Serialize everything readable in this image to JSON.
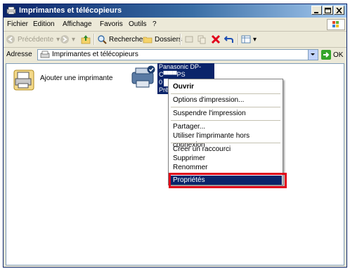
{
  "window": {
    "title": "Imprimantes et télécopieurs",
    "colors": {
      "titlebar": "#0a246a",
      "highlight": "#0a246a",
      "callout": "#e1001a"
    }
  },
  "menubar": {
    "items": [
      "Fichier",
      "Edition",
      "Affichage",
      "Favoris",
      "Outils",
      "?"
    ]
  },
  "toolbar": {
    "back": "Précédente",
    "search": "Rechercher",
    "folders": "Dossiers"
  },
  "address": {
    "label": "Adresse",
    "value": "Imprimantes et télécopieurs",
    "go": "OK"
  },
  "items": {
    "add_printer": "Ajouter une imprimante",
    "printer": {
      "name": "Panasonic DP-C▀▀▀PS",
      "docs": "0",
      "status": "Prêt"
    }
  },
  "context_menu": {
    "items": [
      "Ouvrir",
      "Options d'impression...",
      "Suspendre l'impression",
      "Partager...",
      "Utiliser l'imprimante hors connexion",
      "Créer un raccourci",
      "Supprimer",
      "Renommer",
      "Propriétés"
    ]
  }
}
